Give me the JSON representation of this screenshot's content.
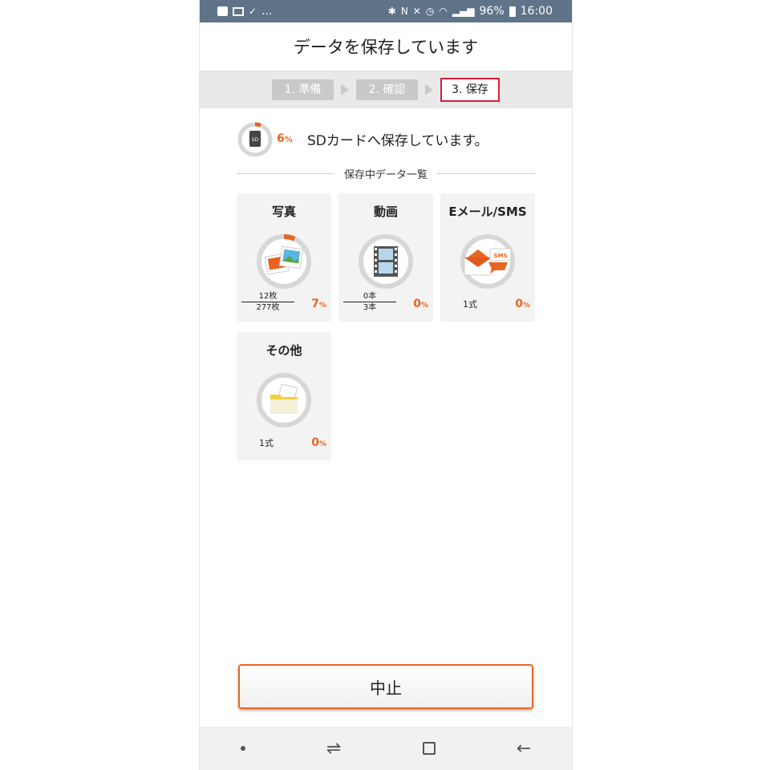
{
  "statusbar": {
    "left_more": "...",
    "battery_pct": "96%",
    "time": "16:00"
  },
  "header": {
    "title": "データを保存しています"
  },
  "steps": [
    {
      "label": "1. 準備",
      "active": false
    },
    {
      "label": "2. 確認",
      "active": false
    },
    {
      "label": "3. 保存",
      "active": true
    }
  ],
  "overall": {
    "icon": "sd-card-icon",
    "icon_label": "SD",
    "percent_value": "6",
    "percent_unit": "%",
    "progress_fraction": 0.06,
    "message": "SDカードへ保存しています。"
  },
  "section": {
    "label": "保存中データ一覧"
  },
  "cards": [
    {
      "title": "写真",
      "icon": "photos-icon",
      "done": "12枚",
      "total": "277枚",
      "percent_value": "7",
      "percent_unit": "%",
      "progress_fraction": 0.07
    },
    {
      "title": "動画",
      "icon": "film-icon",
      "done": "0本",
      "total": "3本",
      "percent_value": "0",
      "percent_unit": "%",
      "progress_fraction": 0
    },
    {
      "title": "Eメール/SMS",
      "icon": "email-sms-icon",
      "icon_label": "SMS",
      "count": "1式",
      "percent_value": "0",
      "percent_unit": "%",
      "progress_fraction": 0
    },
    {
      "title": "その他",
      "icon": "folder-icon",
      "count": "1式",
      "percent_value": "0",
      "percent_unit": "%",
      "progress_fraction": 0
    }
  ],
  "cancel": {
    "label": "中止"
  },
  "navbar": {
    "icons": [
      "dot-icon",
      "recent-apps-icon",
      "home-icon",
      "back-icon"
    ]
  },
  "colors": {
    "accent": "#e8651f",
    "active_step_border": "#d81e3c",
    "statusbar": "#5f7389"
  }
}
